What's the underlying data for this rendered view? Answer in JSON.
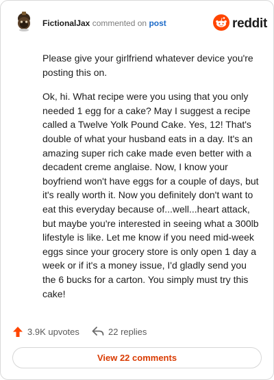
{
  "header": {
    "author": "FictionalJax",
    "action": "commented on",
    "link": "post",
    "brand": "reddit"
  },
  "comment": {
    "paragraphs": [
      "Please give your girlfriend whatever device you're posting this on.",
      "Ok, hi. What recipe were you using that you only needed 1 egg for a cake? May I suggest a recipe called a Twelve Yolk Pound Cake. Yes, 12! That's double of what your husband eats in a day. It's an amazing super rich cake made even better with a decadent creme anglaise. Now, I know your boyfriend won't have eggs for a couple of days, but it's really worth it. Now you definitely don't want to eat this everyday because of...well...heart attack, but maybe you're interested in seeing what a 300lb lifestyle is like. Let me know if you need mid-week eggs since your grocery store is only open 1 day a week or if it's a money issue, I'd gladly send you the 6 bucks for a carton. You simply must try this cake!"
    ]
  },
  "footer": {
    "upvotes": "3.9K upvotes",
    "replies": "22 replies",
    "view_button": "View 22 comments"
  },
  "colors": {
    "brand_orange": "#ff4500",
    "link_blue": "#1c6ac8",
    "button_text": "#d93a00"
  },
  "icons": {
    "avatar": "snoo-avatar-icon",
    "logo": "reddit-logo-icon",
    "upvote": "upvote-arrow-icon",
    "reply": "reply-arrow-icon"
  }
}
